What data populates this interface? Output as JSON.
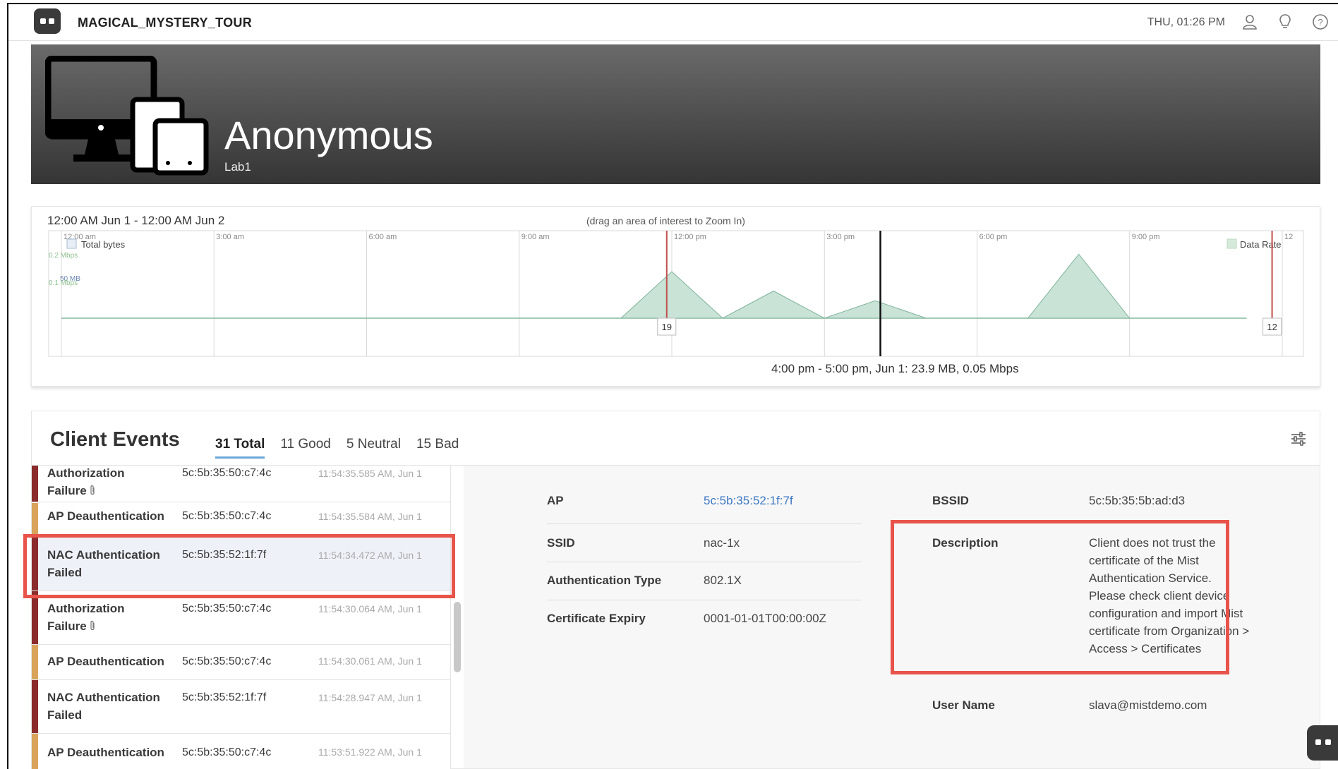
{
  "topbar": {
    "org_name": "MAGICAL_MYSTERY_TOUR",
    "clock": "THU, 01:26 PM",
    "icons": [
      "user-icon",
      "lightbulb-icon",
      "help-icon"
    ]
  },
  "hero": {
    "title": "Anonymous",
    "subtitle": "Lab1",
    "icon": "devices-icon"
  },
  "timeline": {
    "range_label": "12:00 AM Jun 1 - 12:00 AM Jun 2",
    "zoom_hint": "(drag an area of interest to Zoom In)",
    "hover_readout": "4:00 pm - 5:00 pm, Jun 1: 23.9 MB, 0.05 Mbps",
    "legend_left": "Total bytes",
    "legend_right": "Data Rate",
    "ylabels": [
      "0.2 Mbps",
      "50 MB",
      "0.1 Mbps"
    ],
    "xticks": [
      "12:00 am",
      "3:00 am",
      "6:00 am",
      "9:00 am",
      "12:00 pm",
      "3:00 pm",
      "6:00 pm",
      "9:00 pm",
      "12"
    ],
    "markers": [
      {
        "label": "19",
        "hour": 11.9,
        "color": "#c0504d"
      },
      {
        "label": "12",
        "hour": 23.8,
        "color": "#c0504d"
      }
    ],
    "cursor_hour": 16.1,
    "colors": {
      "area": "#c9e3d6",
      "area_stroke": "#7fb39a",
      "baseline": "#8ec2a6",
      "grid": "#d8d8d8",
      "cursor": "#111111"
    },
    "series_mb": [
      {
        "hour": 0,
        "mb": 0
      },
      {
        "hour": 11,
        "mb": 0
      },
      {
        "hour": 12,
        "mb": 48
      },
      {
        "hour": 13,
        "mb": 0
      },
      {
        "hour": 14,
        "mb": 28
      },
      {
        "hour": 15,
        "mb": 0
      },
      {
        "hour": 16,
        "mb": 18
      },
      {
        "hour": 17,
        "mb": 0
      },
      {
        "hour": 19,
        "mb": 0
      },
      {
        "hour": 20,
        "mb": 66
      },
      {
        "hour": 21,
        "mb": 0
      },
      {
        "hour": 23.3,
        "mb": 0
      }
    ]
  },
  "events": {
    "title": "Client Events",
    "tabs": [
      {
        "label": "31 Total",
        "active": true
      },
      {
        "label": "11 Good",
        "active": false
      },
      {
        "label": "5 Neutral",
        "active": false
      },
      {
        "label": "15 Bad",
        "active": false
      }
    ],
    "list": [
      {
        "type_line1": "Authorization",
        "type_line2": "Failure",
        "clip": true,
        "mac": "5c:5b:35:50:c7:4c",
        "time": "11:54:35.585 AM, Jun 1",
        "severity": "bad"
      },
      {
        "type_line1": "AP Deauthentication",
        "type_line2": "",
        "clip": false,
        "mac": "5c:5b:35:50:c7:4c",
        "time": "11:54:35.584 AM, Jun 1",
        "severity": "neutral"
      },
      {
        "type_line1": "NAC Authentication",
        "type_line2": "Failed",
        "clip": false,
        "mac": "5c:5b:35:52:1f:7f",
        "time": "11:54:34.472 AM, Jun 1",
        "severity": "bad",
        "selected": true
      },
      {
        "type_line1": "Authorization",
        "type_line2": "Failure",
        "clip": true,
        "mac": "5c:5b:35:50:c7:4c",
        "time": "11:54:30.064 AM, Jun 1",
        "severity": "bad"
      },
      {
        "type_line1": "AP Deauthentication",
        "type_line2": "",
        "clip": false,
        "mac": "5c:5b:35:50:c7:4c",
        "time": "11:54:30.061 AM, Jun 1",
        "severity": "neutral"
      },
      {
        "type_line1": "NAC Authentication",
        "type_line2": "Failed",
        "clip": false,
        "mac": "5c:5b:35:52:1f:7f",
        "time": "11:54:28.947 AM, Jun 1",
        "severity": "bad"
      },
      {
        "type_line1": "AP Deauthentication",
        "type_line2": "",
        "clip": false,
        "mac": "5c:5b:35:50:c7:4c",
        "time": "11:53:51.922 AM, Jun 1",
        "severity": "neutral"
      }
    ],
    "severity_colors": {
      "bad": "#8b2b2b",
      "neutral": "#d9a35c",
      "good": "#5ea46a"
    }
  },
  "detail": {
    "ap_label": "AP",
    "ap_value": "5c:5b:35:52:1f:7f",
    "ssid_label": "SSID",
    "ssid_value": "nac-1x",
    "auth_label": "Authentication Type",
    "auth_value": "802.1X",
    "cert_label": "Certificate Expiry",
    "cert_value": "0001-01-01T00:00:00Z",
    "bssid_label": "BSSID",
    "bssid_value": "5c:5b:35:5b:ad:d3",
    "desc_label": "Description",
    "desc_value": "Client does not trust the certificate of the Mist Authentication Service. Please check client device configuration and import Mist certificate from Organization > Access > Certificates",
    "user_label": "User Name",
    "user_value": "slava@mistdemo.com"
  },
  "highlight_color": "#e8534a"
}
